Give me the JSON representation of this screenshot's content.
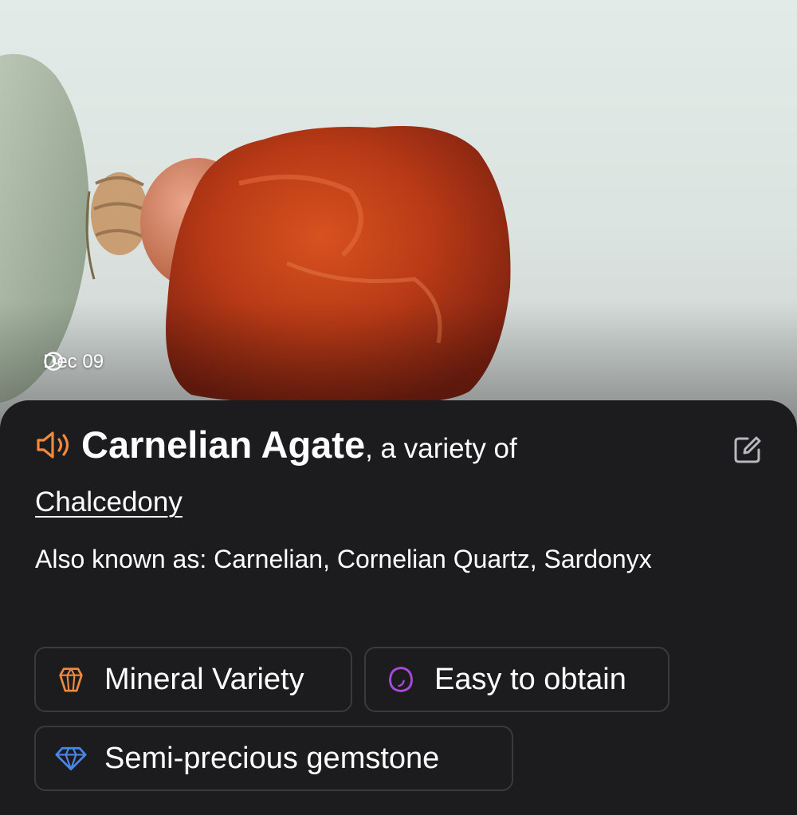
{
  "photo": {
    "subject_icon": "carnelian-bead-photo",
    "date": "Dec 09",
    "date_icon": "clock-icon"
  },
  "header": {
    "speaker_icon": "speaker-icon",
    "name": "Carnelian Agate",
    "variety_text": ", a variety of",
    "parent": "Chalcedony",
    "edit_icon": "edit-icon"
  },
  "aka": {
    "text": "Also known as: Carnelian, Cornelian Quartz, Sardonyx"
  },
  "tags": [
    {
      "label": "Mineral Variety",
      "icon": "crystal-icon",
      "color": "#f08a3c"
    },
    {
      "label": "Easy to obtain",
      "icon": "pebble-icon",
      "color": "#a84ad9"
    },
    {
      "label": "Semi-precious gemstone",
      "icon": "diamond-icon",
      "color": "#4a86e8"
    }
  ],
  "colors": {
    "sheet_bg": "#1c1c1e",
    "accent_orange": "#f08a3c",
    "text": "#ffffff",
    "border": "#3a3a3c"
  }
}
